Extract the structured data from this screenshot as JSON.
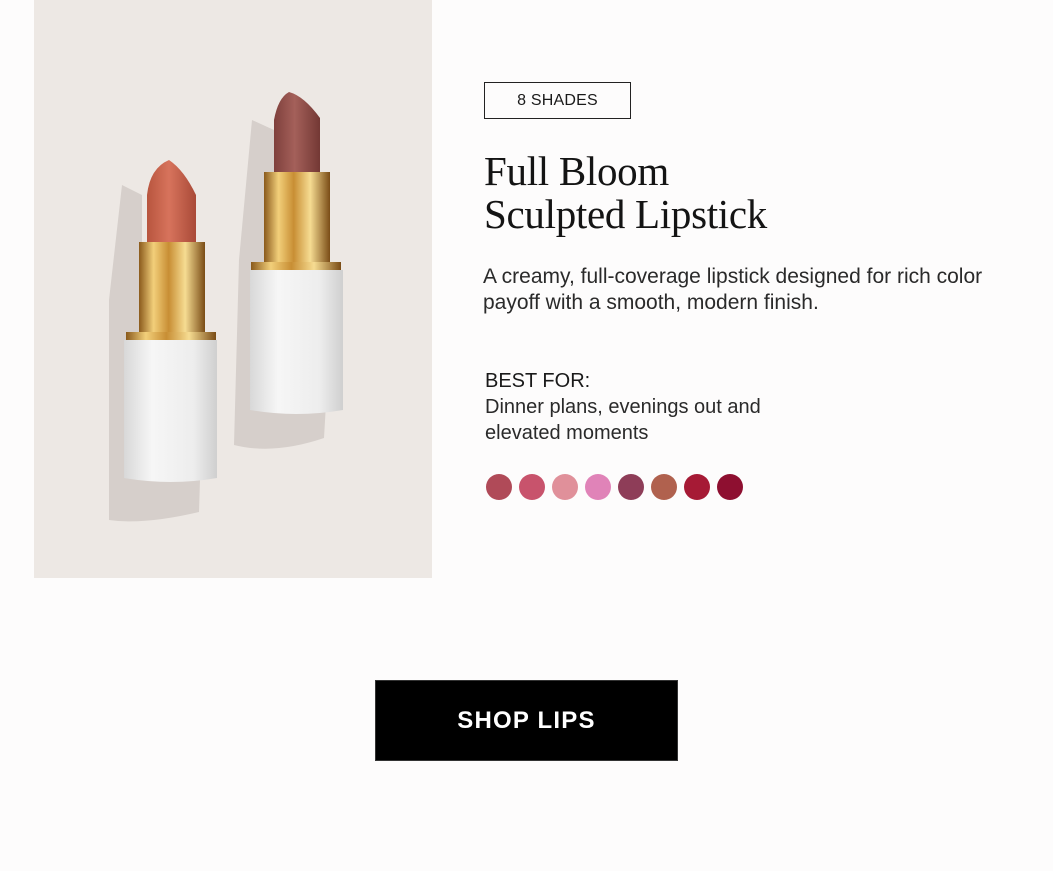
{
  "product": {
    "shade_badge": "8 SHADES",
    "title_line1": "Full Bloom",
    "title_line2": "Sculpted Lipstick",
    "description": "A creamy, full-coverage lipstick designed for rich color payoff with a smooth, modern finish.",
    "best_for_label": "BEST FOR:",
    "best_for_text": "Dinner plans, evenings out and elevated moments"
  },
  "image": {
    "background": "#ede8e4",
    "lipstick_icons": [
      "lipstick-coral-icon",
      "lipstick-mauve-icon"
    ]
  },
  "swatches": [
    {
      "name": "swatch-1",
      "color": "#b04a58"
    },
    {
      "name": "swatch-2",
      "color": "#c8536c"
    },
    {
      "name": "swatch-3",
      "color": "#e0909a"
    },
    {
      "name": "swatch-4",
      "color": "#e083b8"
    },
    {
      "name": "swatch-5",
      "color": "#8e3d58"
    },
    {
      "name": "swatch-6",
      "color": "#b0614e"
    },
    {
      "name": "swatch-7",
      "color": "#a61a35"
    },
    {
      "name": "swatch-8",
      "color": "#8e0f30"
    }
  ],
  "cta": {
    "label": "SHOP LIPS"
  }
}
